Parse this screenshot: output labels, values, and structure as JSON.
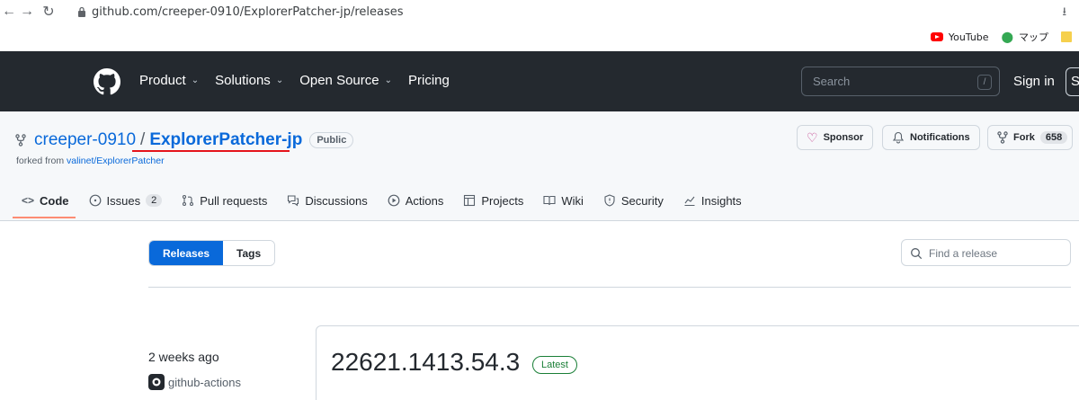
{
  "browser": {
    "url": "github.com/creeper-0910/ExplorerPatcher-jp/releases",
    "bookmarks": [
      "YouTube",
      "マップ"
    ]
  },
  "header": {
    "nav": [
      {
        "label": "Product",
        "dropdown": true
      },
      {
        "label": "Solutions",
        "dropdown": true
      },
      {
        "label": "Open Source",
        "dropdown": true
      },
      {
        "label": "Pricing",
        "dropdown": false
      }
    ],
    "search_placeholder": "Search",
    "search_shortcut": "/",
    "signin": "Sign in",
    "signup_partial": "S"
  },
  "repo": {
    "owner": "creeper-0910",
    "separator": "/",
    "name": "ExplorerPatcher-jp",
    "visibility": "Public",
    "forked_prefix": "forked from",
    "forked_from": "valinet/ExplorerPatcher",
    "sponsor": "Sponsor",
    "notifications": "Notifications",
    "fork": "Fork",
    "fork_count": "658",
    "tabs": [
      {
        "label": "Code",
        "icon": "code-icon",
        "active": true
      },
      {
        "label": "Issues",
        "icon": "issue-icon",
        "count": "2"
      },
      {
        "label": "Pull requests",
        "icon": "pull-request-icon"
      },
      {
        "label": "Discussions",
        "icon": "discussions-icon"
      },
      {
        "label": "Actions",
        "icon": "actions-icon"
      },
      {
        "label": "Projects",
        "icon": "projects-icon"
      },
      {
        "label": "Wiki",
        "icon": "wiki-icon"
      },
      {
        "label": "Security",
        "icon": "security-icon"
      },
      {
        "label": "Insights",
        "icon": "insights-icon"
      }
    ]
  },
  "releases": {
    "segment": [
      "Releases",
      "Tags"
    ],
    "find_placeholder": "Find a release",
    "items": [
      {
        "time": "2 weeks ago",
        "author": "github-actions",
        "title": "22621.1413.54.3",
        "badge": "Latest"
      }
    ]
  },
  "colors": {
    "header_bg": "#24292f",
    "link": "#0969da",
    "accent_tab": "#fd8c73",
    "latest_green": "#1a7f37",
    "annotation_red": "#e5141b"
  }
}
